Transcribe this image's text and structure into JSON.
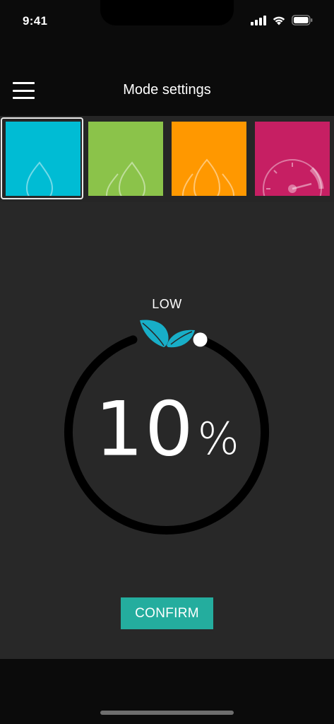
{
  "status_bar": {
    "time": "9:41",
    "icons": [
      "signal-icon",
      "wifi-icon",
      "battery-icon"
    ]
  },
  "header": {
    "title": "Mode settings",
    "menu_icon": "hamburger-menu-icon"
  },
  "modes": [
    {
      "name": "mode-1",
      "color": "#00bcd4",
      "icon": "single-flame-icon",
      "selected": true
    },
    {
      "name": "mode-2",
      "color": "#8bc34a",
      "icon": "double-flame-icon",
      "selected": false
    },
    {
      "name": "mode-3",
      "color": "#ff9800",
      "icon": "triple-flame-icon",
      "selected": false
    },
    {
      "name": "mode-4",
      "color": "#c61f63",
      "icon": "speedometer-icon",
      "selected": false
    }
  ],
  "dial": {
    "level_label": "LOW",
    "value": "10",
    "unit": "%",
    "leaf_icon": "eco-leaves-icon",
    "leaf_color": "#18aec7",
    "fraction": 0.1
  },
  "confirm": {
    "label": "CONFIRM",
    "color": "#24ad9e"
  }
}
